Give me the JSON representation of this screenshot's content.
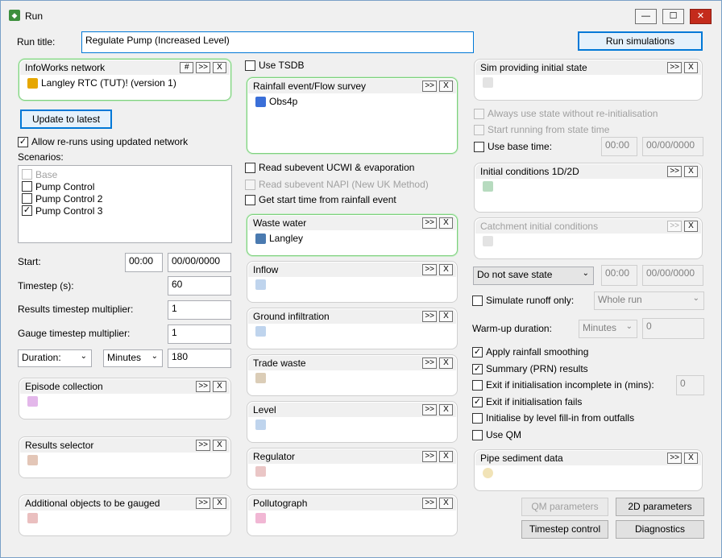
{
  "window": {
    "title": "Run",
    "minimize": "—",
    "maximize": "☐",
    "close": "✕"
  },
  "run_title_label": "Run title:",
  "run_title_value": "Regulate Pump (Increased Level)",
  "run_simulations": "Run simulations",
  "infoworks": {
    "title": "InfoWorks network",
    "hash": "#",
    "more": ">>",
    "x": "X",
    "item": "Langley RTC (TUT)! (version 1)"
  },
  "update_to_latest": "Update to latest",
  "allow_reruns": "Allow re-runs using updated network",
  "scenarios_label": "Scenarios:",
  "scenarios": [
    {
      "label": "Base",
      "checked": false,
      "disabled": true
    },
    {
      "label": "Pump Control",
      "checked": false,
      "disabled": false
    },
    {
      "label": "Pump Control 2",
      "checked": false,
      "disabled": false
    },
    {
      "label": "Pump Control 3",
      "checked": true,
      "disabled": false
    }
  ],
  "start_label": "Start:",
  "start_time": "00:00",
  "start_date": "00/00/0000",
  "timestep_label": "Timestep (s):",
  "timestep_value": "60",
  "results_mult_label": "Results timestep multiplier:",
  "results_mult_value": "1",
  "gauge_mult_label": "Gauge timestep multiplier:",
  "gauge_mult_value": "1",
  "duration_select": "Duration:",
  "minutes_select": "Minutes",
  "duration_value": "180",
  "episode": "Episode collection",
  "results_selector": "Results selector",
  "additional_objects": "Additional objects to be gauged",
  "use_tsdb": "Use TSDB",
  "rainfall": {
    "title": "Rainfall event/Flow survey",
    "item": "Obs4p"
  },
  "read_ucwi": "Read subevent UCWI & evaporation",
  "read_napi": "Read subevent NAPI (New UK Method)",
  "get_start_time": "Get start time from rainfall event",
  "waste_water": {
    "title": "Waste water",
    "item": "Langley"
  },
  "inflow": "Inflow",
  "ground_infiltration": "Ground infiltration",
  "trade_waste": "Trade waste",
  "level": "Level",
  "regulator": "Regulator",
  "pollutograph": "Pollutograph",
  "sim_initial_state": "Sim providing initial state",
  "always_use_state": "Always use state without re-initialisation",
  "start_running": "Start running from state time",
  "use_base_time": "Use base time:",
  "base_time": "00:00",
  "base_date": "00/00/0000",
  "initial_conditions": "Initial conditions 1D/2D",
  "catchment_initial": "Catchment initial conditions",
  "save_state_select": "Do not save state",
  "save_time": "00:00",
  "save_date": "00/00/0000",
  "simulate_runoff": "Simulate runoff only:",
  "whole_run": "Whole run",
  "warmup_label": "Warm-up duration:",
  "warmup_units": "Minutes",
  "warmup_value": "0",
  "apply_rainfall": "Apply rainfall smoothing",
  "summary_prn": "Summary (PRN) results",
  "exit_incomplete": "Exit if initialisation incomplete in (mins):",
  "exit_incomplete_value": "0",
  "exit_fails": "Exit if initialisation fails",
  "init_level_fill": "Initialise by level fill-in from outfalls",
  "use_qm": "Use QM",
  "pipe_sediment": "Pipe sediment data",
  "qm_parameters": "QM parameters",
  "params_2d": "2D parameters",
  "timestep_control": "Timestep control",
  "diagnostics": "Diagnostics",
  "common": {
    "more": ">>",
    "x": "X",
    "check": "✓",
    "arrow": "⌄"
  }
}
